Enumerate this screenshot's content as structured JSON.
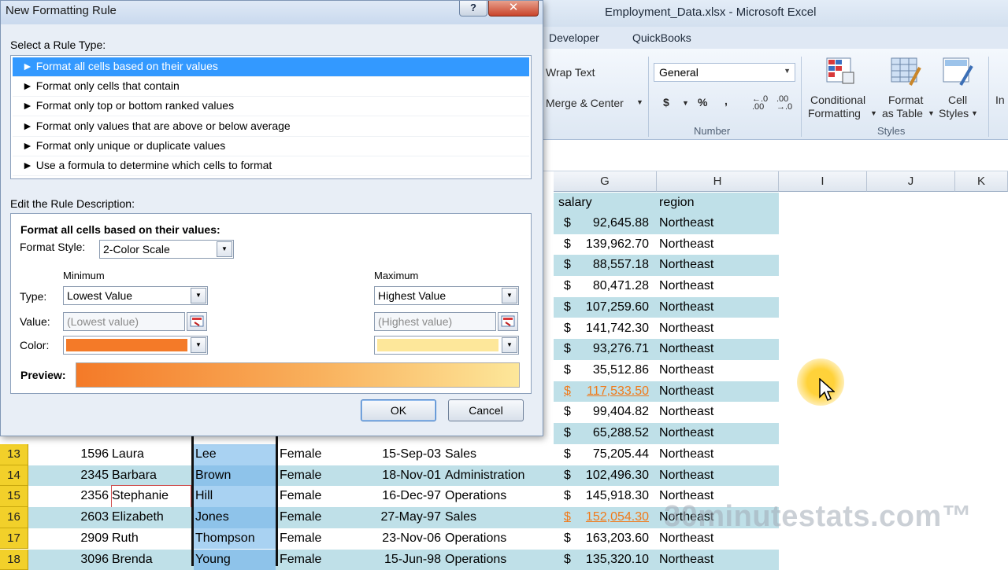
{
  "window": {
    "title": "Employment_Data.xlsx  -  Microsoft Excel",
    "tabs": [
      "Developer",
      "QuickBooks"
    ]
  },
  "ribbon": {
    "wrap_text": "Wrap Text",
    "merge_center": "Merge & Center",
    "number_format": "General",
    "currency_symbol": "$",
    "percent_symbol": "%",
    "comma_symbol": ",",
    "increase_decimal": "←.0 .00",
    "decrease_decimal": ".00 →.0",
    "group_number": "Number",
    "group_styles": "Styles",
    "conditional_formatting_1": "Conditional",
    "conditional_formatting_2": "Formatting",
    "format_table_1": "Format",
    "format_table_2": "as Table",
    "cell_styles_1": "Cell",
    "cell_styles_2": "Styles",
    "insert_partial": "In"
  },
  "sheet": {
    "columns": [
      "G",
      "H",
      "I",
      "J",
      "K"
    ],
    "header_salary": "salary",
    "header_region": "region",
    "upper_rows": [
      {
        "salary": "92,645.88",
        "region": "Northeast",
        "band": true
      },
      {
        "salary": "139,962.70",
        "region": "Northeast",
        "band": false
      },
      {
        "salary": "88,557.18",
        "region": "Northeast",
        "band": true
      },
      {
        "salary": "80,471.28",
        "region": "Northeast",
        "band": false
      },
      {
        "salary": "107,259.60",
        "region": "Northeast",
        "band": true
      },
      {
        "salary": "141,742.30",
        "region": "Northeast",
        "band": false
      },
      {
        "salary": "93,276.71",
        "region": "Northeast",
        "band": true
      },
      {
        "salary": "35,512.86",
        "region": "Northeast",
        "band": false
      },
      {
        "salary": "117,533.50",
        "region": "Northeast",
        "band": true,
        "highlight": true
      },
      {
        "salary": "99,404.82",
        "region": "Northeast",
        "band": false
      },
      {
        "salary": "65,288.52",
        "region": "Northeast",
        "band": true
      }
    ],
    "lower_rows": [
      {
        "row": "13",
        "id": "1596",
        "first": "Laura",
        "last": "Lee",
        "gender": "Female",
        "date": "15-Sep-03",
        "dept": "Sales",
        "salary": "75,205.44",
        "region": "Northeast",
        "band": false
      },
      {
        "row": "14",
        "id": "2345",
        "first": "Barbara",
        "last": "Brown",
        "gender": "Female",
        "date": "18-Nov-01",
        "dept": "Administration",
        "salary": "102,496.30",
        "region": "Northeast",
        "band": true
      },
      {
        "row": "15",
        "id": "2356",
        "first": "Stephanie",
        "last": "Hill",
        "gender": "Female",
        "date": "16-Dec-97",
        "dept": "Operations",
        "salary": "145,918.30",
        "region": "Northeast",
        "band": false
      },
      {
        "row": "16",
        "id": "2603",
        "first": "Elizabeth",
        "last": "Jones",
        "gender": "Female",
        "date": "27-May-97",
        "dept": "Sales",
        "salary": "152,054.30",
        "region": "Northeast",
        "band": true,
        "highlight": true
      },
      {
        "row": "17",
        "id": "2909",
        "first": "Ruth",
        "last": "Thompson",
        "gender": "Female",
        "date": "23-Nov-06",
        "dept": "Operations",
        "salary": "163,203.60",
        "region": "Northeast",
        "band": false
      },
      {
        "row": "18",
        "id": "3096",
        "first": "Brenda",
        "last": "Young",
        "gender": "Female",
        "date": "15-Jun-98",
        "dept": "Operations",
        "salary": "135,320.10",
        "region": "Northeast",
        "band": true
      }
    ],
    "currency": "$"
  },
  "dialog": {
    "title": "New Formatting Rule",
    "help": "?",
    "close": "✕",
    "select_label": "Select a Rule Type:",
    "rule_types": [
      "► Format all cells based on their values",
      "► Format only cells that contain",
      "► Format only top or bottom ranked values",
      "► Format only values that are above or below average",
      "► Format only unique or duplicate values",
      "► Use a formula to determine which cells to format"
    ],
    "edit_label": "Edit the Rule Description:",
    "desc_heading": "Format all cells based on their values:",
    "format_style_label": "Format Style:",
    "format_style_value": "2-Color Scale",
    "minimum_label": "Minimum",
    "maximum_label": "Maximum",
    "type_label": "Type:",
    "value_label": "Value:",
    "color_label": "Color:",
    "min_type": "Lowest Value",
    "max_type": "Highest Value",
    "min_value_placeholder": "(Lowest value)",
    "max_value_placeholder": "(Highest value)",
    "min_color": "#f47a28",
    "max_color": "#fde79a",
    "preview_label": "Preview:",
    "ok": "OK",
    "cancel": "Cancel"
  },
  "watermark": "30minutestats.com™"
}
